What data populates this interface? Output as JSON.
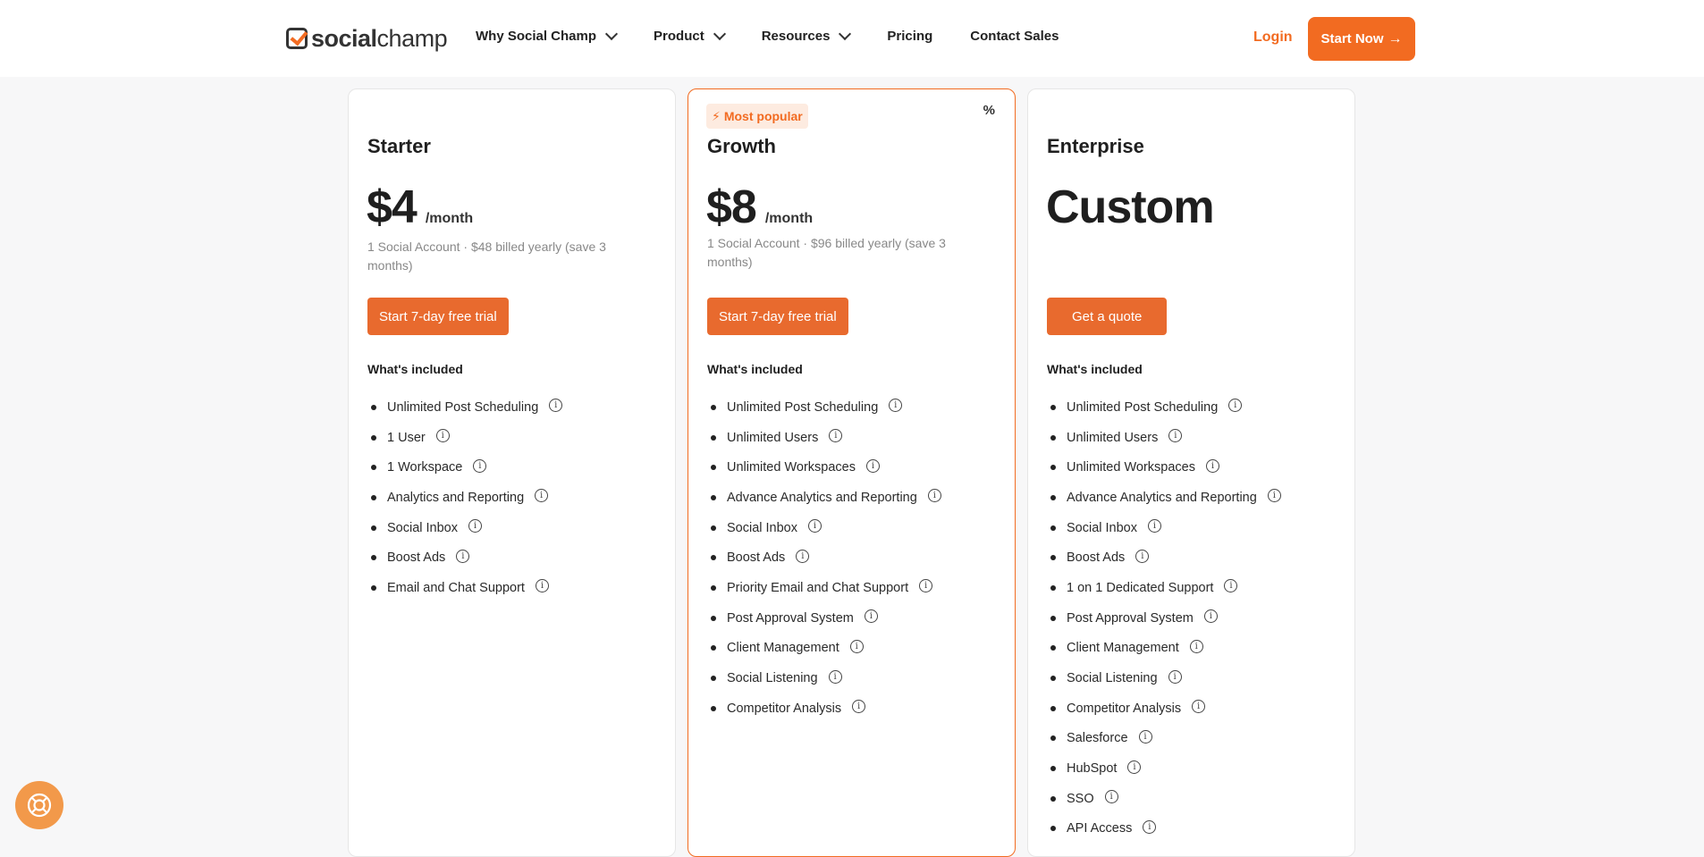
{
  "header": {
    "logo": {
      "part1": "social",
      "part2": "champ"
    },
    "nav": [
      {
        "label": "Why Social Champ",
        "dropdown": true
      },
      {
        "label": "Product",
        "dropdown": true
      },
      {
        "label": "Resources",
        "dropdown": true
      },
      {
        "label": "Pricing",
        "dropdown": false
      },
      {
        "label": "Contact Sales",
        "dropdown": false
      }
    ],
    "login_label": "Login",
    "start_now_label": "Start Now"
  },
  "plans": [
    {
      "name": "Starter",
      "price": "$4",
      "period": "/month",
      "billing": "1 Social Account · $48 billed yearly (save 3 months)",
      "cta": "Start 7-day free trial",
      "included_label": "What's included",
      "features": [
        "Unlimited Post Scheduling",
        "1 User",
        "1 Workspace",
        "Analytics and Reporting",
        "Social Inbox",
        "Boost Ads",
        "Email and Chat Support"
      ]
    },
    {
      "name": "Growth",
      "badge": "Most popular",
      "badge_pct": "%",
      "price": "$8",
      "period": "/month",
      "billing": "1 Social Account · $96 billed yearly (save 3 months)",
      "cta": "Start 7-day free trial",
      "included_label": "What's included",
      "features": [
        "Unlimited Post Scheduling",
        "Unlimited Users",
        "Unlimited Workspaces",
        "Advance Analytics and Reporting",
        "Social Inbox",
        "Boost Ads",
        "Priority Email and Chat Support",
        "Post Approval System",
        "Client Management",
        "Social Listening",
        "Competitor Analysis"
      ]
    },
    {
      "name": "Enterprise",
      "price": "Custom",
      "period": "",
      "billing": "",
      "cta": "Get a quote",
      "included_label": "What's included",
      "features": [
        "Unlimited Post Scheduling",
        "Unlimited Users",
        "Unlimited Workspaces",
        "Advance Analytics and Reporting",
        "Social Inbox",
        "Boost Ads",
        "1 on 1 Dedicated Support",
        "Post Approval System",
        "Client Management",
        "Social Listening",
        "Competitor Analysis",
        "Salesforce",
        "HubSpot",
        "SSO",
        "API Access"
      ]
    }
  ],
  "colors": {
    "brand": "#f26b21",
    "cta": "#e86a2e",
    "badge_bg": "#fdebe0",
    "help": "#f2994a"
  },
  "icons": [
    "chevron-down-icon",
    "arrow-right-icon",
    "info-icon",
    "bolt-icon",
    "percent-icon",
    "lifebuoy-icon"
  ]
}
